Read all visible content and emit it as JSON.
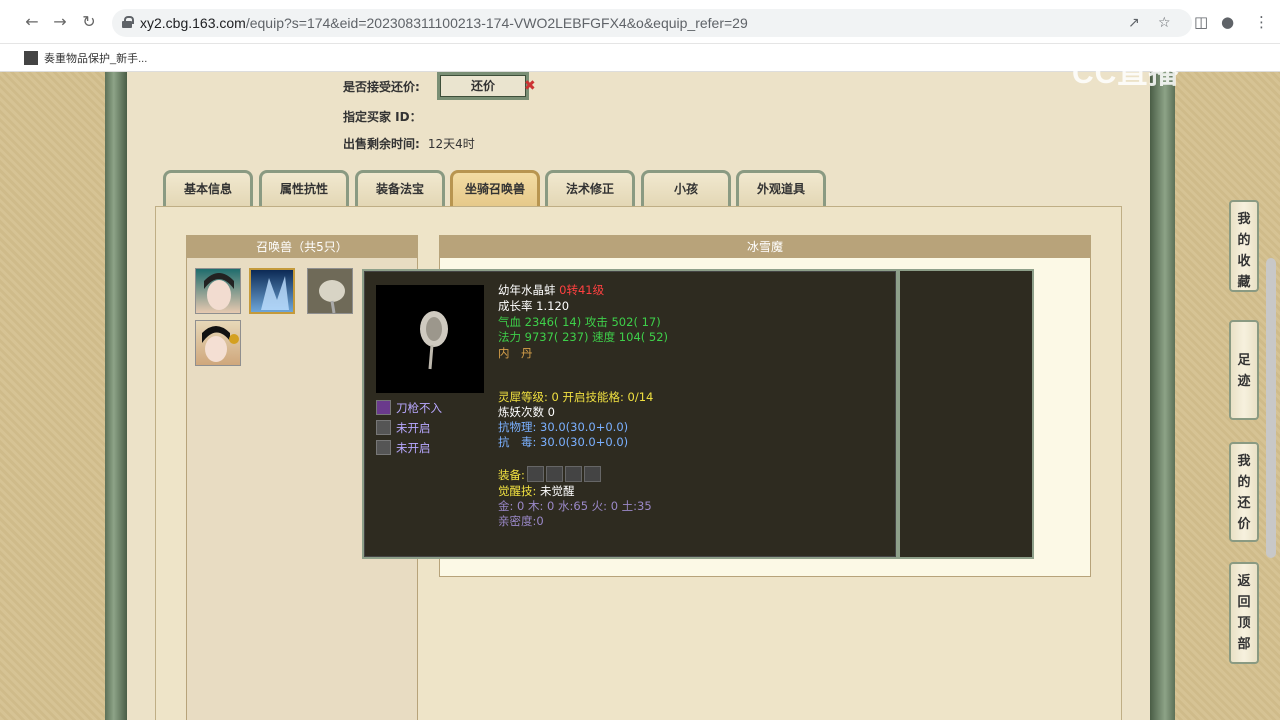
{
  "browser": {
    "url_host": "xy2.cbg.163.com",
    "url_rest": "/equip?s=174&eid=202308311100213-174-VWO2LEBFGFX4&o&equip_refer=29",
    "bookmark": "奏重物品保护_新手..."
  },
  "watermark": "CC直播",
  "info": {
    "accept_offer_label": "是否接受还价:",
    "offer_button": "还价",
    "buyer_id_label": "指定买家 ID：",
    "time_left_label": "出售剩余时间:",
    "time_left_value": "12天4时"
  },
  "tabs": [
    "基本信息",
    "属性抗性",
    "装备法宝",
    "坐骑召唤兽",
    "法术修正",
    "小孩",
    "外观道具"
  ],
  "active_tab": 3,
  "pets_header": "召唤兽（共5只）",
  "detail_header": "冰雪魔",
  "tooltip": {
    "name": "幼年水晶蚌",
    "level": "0转41级",
    "growth": "成长率 1.120",
    "stat1": "气血 2346( 14) 攻击 502( 17)",
    "stat2": "法力 9737( 237) 速度 104( 52)",
    "neidan": "内　丹",
    "skills": [
      "刀枪不入",
      "未开启",
      "未开启"
    ],
    "spirit": "灵犀等级:  0 开启技能格:  0/14",
    "lianyao": "炼妖次数 0",
    "resist_phys": "抗物理: 30.0(30.0+0.0)",
    "resist_poison": "抗　毒: 30.0(30.0+0.0)",
    "equip_label": "装备:",
    "awaken_label": "觉醒技:",
    "awaken_value": "未觉醒",
    "elements": "金: 0 木: 0 水:65 火: 0 土:35",
    "intimacy": "亲密度:0"
  },
  "float_buttons": [
    "我的收藏",
    "足迹",
    "我的还价",
    "返回顶部"
  ]
}
